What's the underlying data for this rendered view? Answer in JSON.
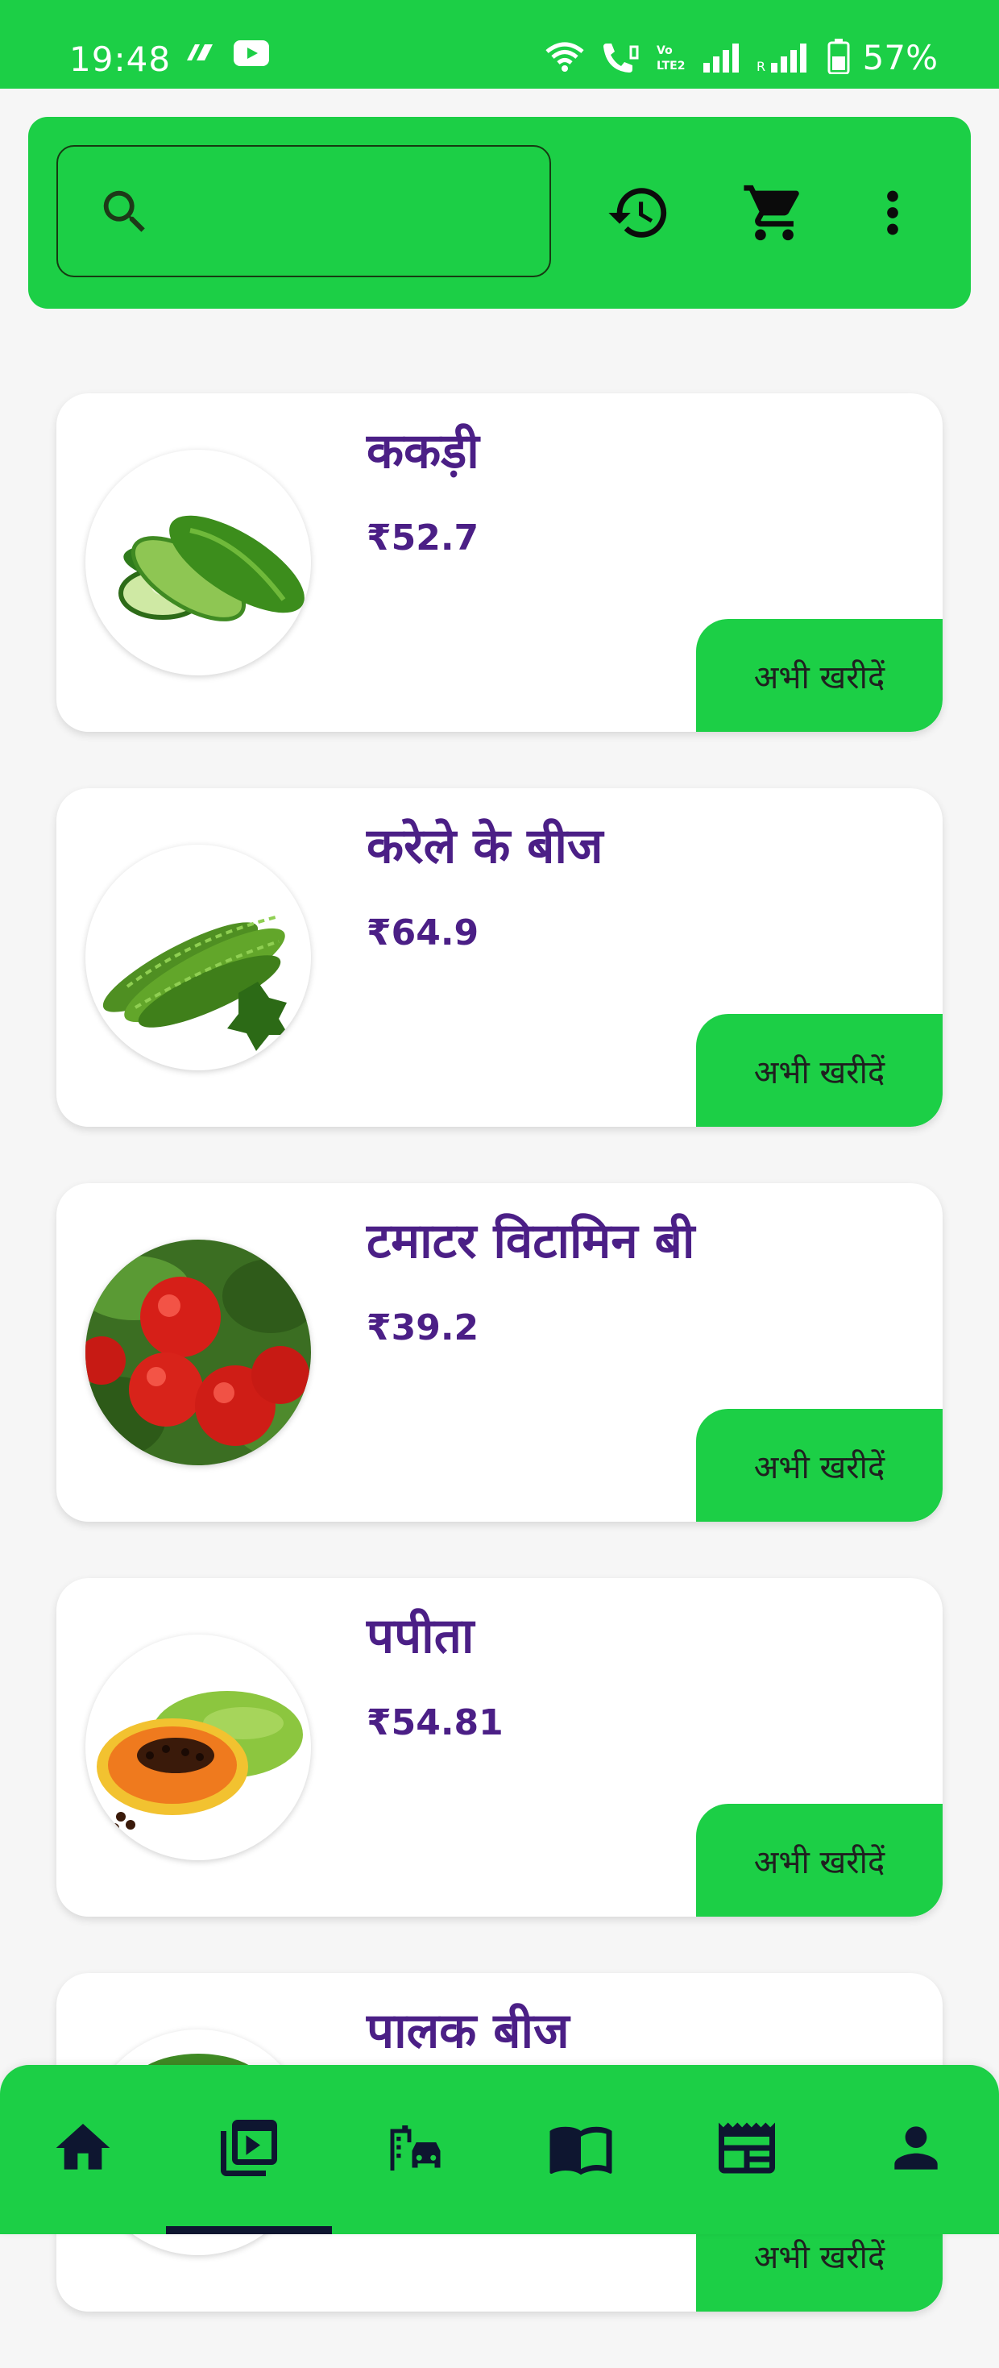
{
  "status_bar": {
    "time": "19:48",
    "battery": "57%",
    "icons": [
      "app-notification-icon",
      "youtube-icon",
      "wifi-icon",
      "wifi-calling-icon",
      "volte-icon",
      "signal-icon",
      "signal-roaming-icon",
      "battery-icon"
    ]
  },
  "search": {
    "value": "",
    "placeholder": ""
  },
  "header_actions": [
    "history-icon",
    "cart-icon",
    "more-vert-icon"
  ],
  "products": [
    {
      "name": "ककड़ी",
      "price": "₹52.7",
      "button": "अभी खरीदें",
      "image": "cucumber"
    },
    {
      "name": "करेले के बीज",
      "price": "₹64.9",
      "button": "अभी खरीदें",
      "image": "bitter-gourd"
    },
    {
      "name": "टमाटर विटामिन बी",
      "price": "₹39.2",
      "button": "अभी खरीदें",
      "image": "tomato"
    },
    {
      "name": "पपीता",
      "price": "₹54.81",
      "button": "अभी खरीदें",
      "image": "papaya"
    },
    {
      "name": "पालक बीज",
      "price": "",
      "button": "अभी खरीदें",
      "image": "spinach"
    }
  ],
  "bottom_nav": {
    "items": [
      "home-icon",
      "shop-icon",
      "transport-icon",
      "book-icon",
      "news-icon",
      "profile-icon"
    ],
    "active_index": 1
  },
  "colors": {
    "primary_green": "#1ccf46",
    "text_purple": "#4b1f86",
    "icon_dark": "#0e1630"
  }
}
